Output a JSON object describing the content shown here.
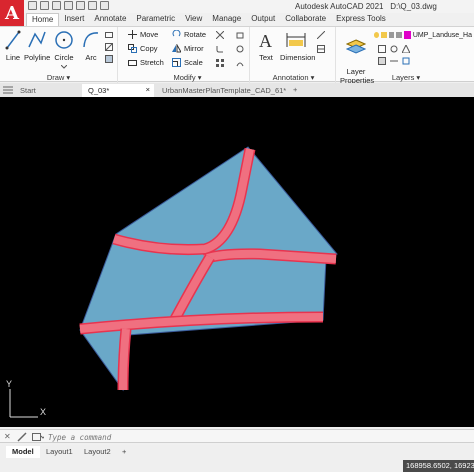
{
  "app": {
    "title": "Autodesk AutoCAD 2021",
    "filename": "D:\\Q_03.dwg",
    "logo_letter": "A"
  },
  "ribbon_tabs": [
    "Home",
    "Insert",
    "Annotate",
    "Parametric",
    "View",
    "Manage",
    "Output",
    "Collaborate",
    "Express Tools"
  ],
  "draw": {
    "line": "Line",
    "polyline": "Polyline",
    "circle": "Circle",
    "arc": "Arc",
    "title": "Draw"
  },
  "modify": {
    "move": "Move",
    "rotate": "Rotate",
    "copy": "Copy",
    "mirror": "Mirror",
    "stretch": "Stretch",
    "scale": "Scale",
    "title": "Modify"
  },
  "annotation": {
    "text": "Text",
    "dimension": "Dimension",
    "title": "Annotation"
  },
  "layers": {
    "layer_properties": "Layer\nProperties",
    "current_layer": "UMP_Landuse_Ha",
    "current_layer_color": "#e000c8",
    "title": "Layers"
  },
  "doc_tabs": {
    "start": "Start",
    "active": "Q_03*",
    "other": "UrbanMasterPlanTemplate_CAD_61*"
  },
  "canvas": {
    "background": "#000000",
    "parcel_fill": "#6aa8c8",
    "road_fill": "#f07080",
    "road_edge": "#e8344f",
    "ucs_y": "Y",
    "ucs_x": "X"
  },
  "command": {
    "placeholder": "Type a command"
  },
  "layout_tabs": [
    "Model",
    "Layout1",
    "Layout2"
  ],
  "status": {
    "coordinates": "168958.6502, 169235..."
  }
}
